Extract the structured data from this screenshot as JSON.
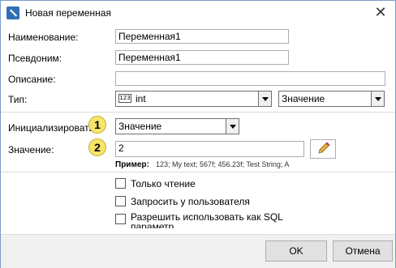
{
  "window": {
    "title": "Новая переменная",
    "close_glyph": "✕"
  },
  "form": {
    "name_label": "Наименование:",
    "name_value": "Переменная1",
    "alias_label": "Псевдоним:",
    "alias_value": "Переменная1",
    "description_label": "Описание:",
    "description_value": "",
    "type_label": "Тип:",
    "type_value": "int",
    "type_icon": "123",
    "type_mode_value": "Значение",
    "init_label": "Инициализировать:",
    "init_value": "Значение",
    "value_label": "Значение:",
    "value_value": "2",
    "example_label": "Пример:",
    "example_text": "123; My text; 567f; 456.23f; Test String; A"
  },
  "annotations": {
    "badge1": "1",
    "badge2": "2"
  },
  "options": {
    "readonly_label": "Только чтение",
    "ask_user_label": "Запросить у пользователя",
    "sql_param_label": "Разрешить использовать как SQL параметр"
  },
  "buttons": {
    "ok": "OK",
    "cancel": "Отмена"
  },
  "colors": {
    "badge": "#f7e46a",
    "accent": "#2f6fb6"
  }
}
